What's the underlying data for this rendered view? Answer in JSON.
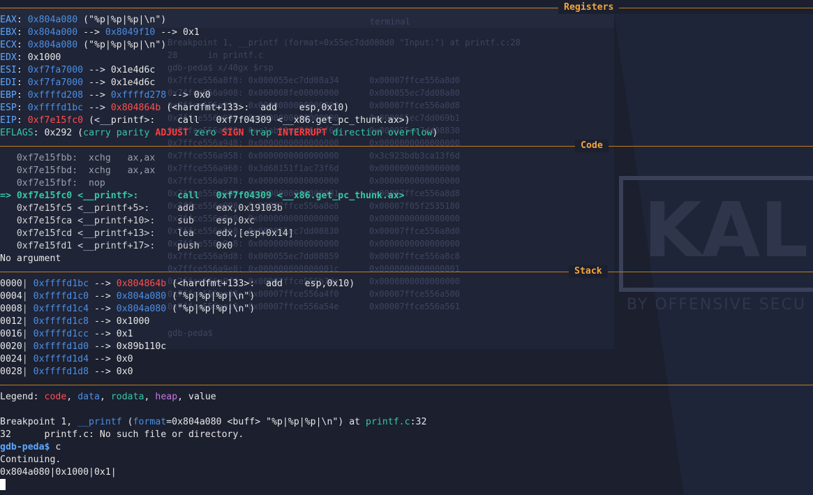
{
  "colors": {
    "background": "#1b1f2e",
    "separator": "#c27b1e",
    "section_title": "#f6a53a",
    "register": "#5fa8ff",
    "data": "#4b8fe6",
    "code": "#ff5050",
    "current": "#36c7a5",
    "heap": "#c678dd"
  },
  "sections": {
    "registers": "Registers",
    "code": "Code",
    "stack": "Stack"
  },
  "registers": {
    "eax": {
      "name": "EAX",
      "addr": "0x804a080",
      "rest": " (\"%p|%p|%p|\\n\")"
    },
    "ebx": {
      "name": "EBX",
      "addr": "0x804a000",
      "mid": " --> ",
      "addr2": "0x8049f10",
      "rest": " --> 0x1"
    },
    "ecx": {
      "name": "ECX",
      "addr": "0x804a080",
      "rest": " (\"%p|%p|%p|\\n\")"
    },
    "edx": {
      "name": "EDX",
      "value": "0x1000"
    },
    "esi": {
      "name": "ESI",
      "addr": "0xf7fa7000",
      "rest": " --> 0x1e4d6c"
    },
    "edi": {
      "name": "EDI",
      "addr": "0xf7fa7000",
      "rest": " --> 0x1e4d6c"
    },
    "ebp": {
      "name": "EBP",
      "addr": "0xffffd208",
      "mid": " --> ",
      "addr2": "0xffffd278",
      "rest": " --> 0x0"
    },
    "esp": {
      "name": "ESP",
      "addr": "0xffffd1bc",
      "mid": " --> ",
      "code": "0x804864b",
      "rest": " (<hardfmt+133>:  add    esp,0x10)"
    },
    "eip": {
      "name": "EIP",
      "code": "0xf7e15fc0",
      "rest": " (<__printf>:    call   0xf7f04309 <__x86.get_pc_thunk.ax>)"
    },
    "eflags": {
      "name": "EFLAGS",
      "value": " 0x292 (",
      "f_carry": "carry",
      "f_parity": "parity",
      "f_adjust": "ADJUST",
      "f_zero": "zero",
      "f_sign": "SIGN",
      "f_trap": "trap",
      "f_interrupt": "INTERRUPT",
      "f_direction": "direction",
      "f_overflow": "overflow",
      "close": ")"
    }
  },
  "code": {
    "l1": "   0xf7e15fbb:  xchg   ax,ax",
    "l2": "   0xf7e15fbd:  xchg   ax,ax",
    "l3": "   0xf7e15fbf:  nop",
    "current": "=> 0xf7e15fc0 <__printf>:       call   0xf7f04309 <__x86.get_pc_thunk.ax>",
    "l5": "   0xf7e15fc5 <__printf+5>:     add    eax,0x19103b",
    "l6": "   0xf7e15fca <__printf+10>:    sub    esp,0xc",
    "l7": "   0xf7e15fcd <__printf+13>:    lea    edx,[esp+0x14]",
    "l8": "   0xf7e15fd1 <__printf+17>:    push   0x0",
    "no_argument": "No argument"
  },
  "stack": {
    "r0": {
      "off": "0000",
      "addr": "0xffffd1bc",
      "mid": " --> ",
      "code": "0x804864b",
      "rest": " (<hardfmt+133>:  add    esp,0x10)"
    },
    "r1": {
      "off": "0004",
      "addr": "0xffffd1c0",
      "mid": " --> ",
      "addr2": "0x804a080",
      "rest": " (\"%p|%p|%p|\\n\")"
    },
    "r2": {
      "off": "0008",
      "addr": "0xffffd1c4",
      "mid": " --> ",
      "addr2": "0x804a080",
      "rest": " (\"%p|%p|%p|\\n\")"
    },
    "r3": {
      "off": "0012",
      "addr": "0xffffd1c8",
      "rest": " --> 0x1000"
    },
    "r4": {
      "off": "0016",
      "addr": "0xffffd1cc",
      "rest": " --> 0x1"
    },
    "r5": {
      "off": "0020",
      "addr": "0xffffd1d0",
      "rest": " --> 0x89b110c"
    },
    "r6": {
      "off": "0024",
      "addr": "0xffffd1d4",
      "rest": " --> 0x0"
    },
    "r7": {
      "off": "0028",
      "addr": "0xffffd1d8",
      "rest": " --> 0x0"
    }
  },
  "legend": {
    "label": "Legend: ",
    "code": "code",
    "data": "data",
    "rodata": "rodata",
    "heap": "heap",
    "value": "value"
  },
  "terminal": {
    "bp_prefix": "Breakpoint 1, ",
    "bp_func": "__printf",
    "bp_open": " (",
    "bp_arg": "format",
    "bp_args_rest": "=0x804a080 <buff> \"%p|%p|%p|\\n\") at ",
    "bp_file": "printf.c",
    "bp_line": ":32",
    "src_line": "32      printf.c: No such file or directory.",
    "prompt": "gdb-peda$",
    "command": " c",
    "continuing": "Continuing.",
    "output": "0x804a080|0x1000|0x1|"
  },
  "background_window": {
    "title": "terminal",
    "bp_line": "Breakpoint 1, __printf (format=0x55ec7dd080d0 \"Input:\") at printf.c:28",
    "src_line": "28      in printf.c",
    "cmd": "gdb-peda$ x/40gx $rsp",
    "rows": [
      "0x7ffce556a8f8: 0x000055ec7dd08a34      0x00007ffce556a8d0",
      "0x7ffce556a908: 0x000008fe00000000      0x000055ec7dd08a80",
      "0x7ffce556a918: 0x0000000000000000      0x00007ffce556a0d8",
      "0x7ffce556a928: 0x0000000000000000      0x000055ec7dd069b1",
      "0x7ffce556a938: 0xc1ab10ad7f6d5f6d      0x000055ec7dd08830",
      "0x7ffce556a948: 0x0000000000000000      0x0000000000000000",
      "0x7ffce556a958: 0x0000000000000000      0x3c923bdb3ca13f6d",
      "0x7ffce556a968: 0x3d68151f1ac73f6d      0x0000000000000000",
      "0x7ffce556a978: 0x0000000000000000      0x0000000000000000",
      "0x7ffce556a988: 0x0000000000000001      0x00007ffce556a8d8",
      "0x7ffce556a998: 0x00007ffce556a8e8      0x00007f05f2535180",
      "0x7ffce556a9a8: 0x0000000000000000      0x0000000000000000",
      "0x7ffce556a9b8: 0x000055ec7dd08830      0x00007ffce556a8d0",
      "0x7ffce556a9c8: 0x0000000000000000      0x0000000000000000",
      "0x7ffce556a9d8: 0x000055ec7dd08859      0x00007ffce556a8c8",
      "0x7ffce556a9e8: 0x000000000000001c      0x0000000000000001",
      "0x7ffce556a9f8: 0x00007ffce556b7dc      0x0000000000000000",
      "0x7ffce556aa08: 0x00007ffce556a4f0      0x00007ffce556a500",
      "0x7ffce556aa18: 0x00007ffce556a54e      0x00007ffce556a561"
    ],
    "prompt": "gdb-peda$",
    "logo": "KALI",
    "tagline": "BY OFFENSIVE SECU"
  }
}
